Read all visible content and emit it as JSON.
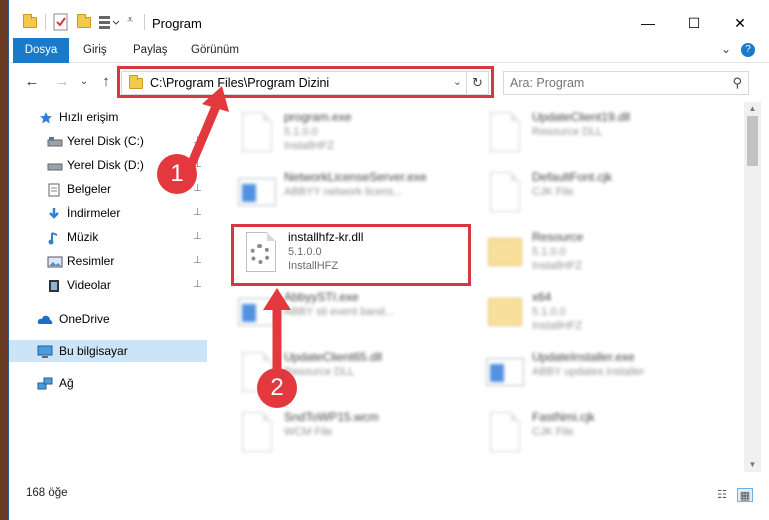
{
  "window": {
    "title": "Program",
    "minimize": "—",
    "maximize": "☐",
    "close": "✕"
  },
  "ribbon": {
    "tabs": [
      "Dosya",
      "Giriş",
      "Paylaş",
      "Görünüm"
    ],
    "expand": "⌄",
    "help": "?"
  },
  "nav": {
    "back": "←",
    "forward": "→",
    "recent": "⌄",
    "up": "↑",
    "address": "C:\\Program Files\\Program Dizini",
    "address_dropdown": "⌄",
    "refresh": "↻",
    "search_placeholder": "Ara: Program",
    "search_icon_glyph": "⚲"
  },
  "sidebar": {
    "items": [
      {
        "label": "Hızlı erişim",
        "icon": "star-icon",
        "pinned": false
      },
      {
        "label": "Yerel Disk (C:)",
        "icon": "drive-icon",
        "pinned": true
      },
      {
        "label": "Yerel Disk (D:)",
        "icon": "drive-icon",
        "pinned": true
      },
      {
        "label": "Belgeler",
        "icon": "documents-icon",
        "pinned": true
      },
      {
        "label": "İndirmeler",
        "icon": "download-icon",
        "pinned": true
      },
      {
        "label": "Müzik",
        "icon": "music-icon",
        "pinned": true
      },
      {
        "label": "Resimler",
        "icon": "pictures-icon",
        "pinned": true
      },
      {
        "label": "Videolar",
        "icon": "videos-icon",
        "pinned": true
      },
      {
        "label": "OneDrive",
        "icon": "cloud-icon",
        "pinned": false
      },
      {
        "label": "Bu bilgisayar",
        "icon": "computer-icon",
        "pinned": false,
        "selected": true
      },
      {
        "label": "Ağ",
        "icon": "network-icon",
        "pinned": false
      }
    ],
    "pin_glyph": "📌"
  },
  "files": [
    {
      "name": "program.exe",
      "sub1": "5.1.0.0",
      "sub2": "InstallHFZ",
      "icon": "exe-icon",
      "blurred": true
    },
    {
      "name": "UpdateClient19.dll",
      "sub1": "Resource DLL",
      "sub2": "",
      "icon": "dll-icon",
      "blurred": true
    },
    {
      "name": "NetworkLicenseServer.exe",
      "sub1": "ABBYY network licens...",
      "sub2": "",
      "icon": "app-icon",
      "blurred": true
    },
    {
      "name": "DefaultFont.cjk",
      "sub1": "CJK File",
      "sub2": "",
      "icon": "file-icon",
      "blurred": true
    },
    {
      "name": "installhfz-kr.dll",
      "sub1": "5.1.0.0",
      "sub2": "InstallHFZ",
      "icon": "dll-icon",
      "blurred": false
    },
    {
      "name": "Resource",
      "sub1": "5.1.0.0",
      "sub2": "InstallHFZ",
      "icon": "folder-icon",
      "blurred": true
    },
    {
      "name": "AbbyySTI.exe",
      "sub1": "ABBY sti event band...",
      "sub2": "",
      "icon": "app-icon",
      "blurred": true
    },
    {
      "name": "x64",
      "sub1": "5.1.0.0",
      "sub2": "InstallHFZ",
      "icon": "folder-icon",
      "blurred": true
    },
    {
      "name": "UpdateClient65.dll",
      "sub1": "Resource DLL",
      "sub2": "",
      "icon": "dll-icon",
      "blurred": true
    },
    {
      "name": "UpdateInstaller.exe",
      "sub1": "ABBY updates installer",
      "sub2": "",
      "icon": "app-icon",
      "blurred": true
    },
    {
      "name": "SndToWP15.wcm",
      "sub1": "WCM File",
      "sub2": "",
      "icon": "file-icon",
      "blurred": true
    },
    {
      "name": "FastNmi.cjk",
      "sub1": "CJK File",
      "sub2": "",
      "icon": "file-icon",
      "blurred": true
    }
  ],
  "status": {
    "count": "168 öğe",
    "details_view_glyph": "☷",
    "tiles_view_glyph": "▦"
  },
  "annotations": {
    "badge1": "1",
    "badge2": "2"
  },
  "colors": {
    "accent": "#1979ca",
    "highlight": "#d9373f",
    "selected": "#cce4f7"
  }
}
